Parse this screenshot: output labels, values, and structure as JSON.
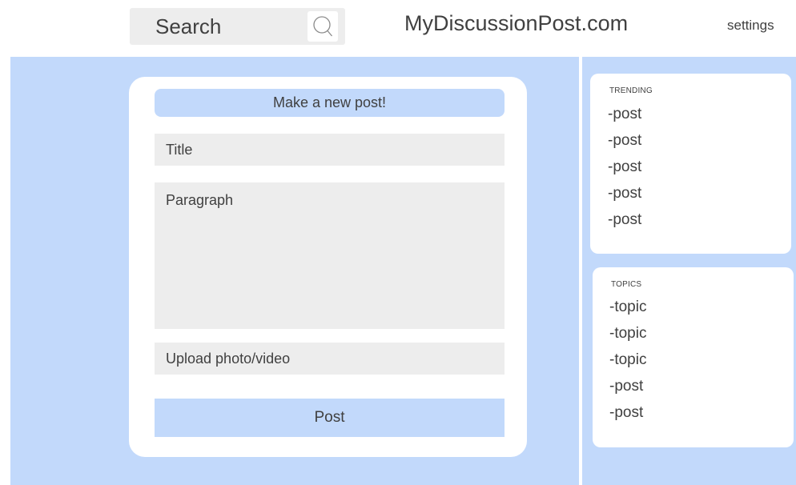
{
  "header": {
    "search_label": "Search",
    "site_title": "MyDiscussionPost.com",
    "settings_label": "settings"
  },
  "post_form": {
    "heading": "Make a new post!",
    "title_placeholder": "Title",
    "paragraph_placeholder": "Paragraph",
    "upload_label": "Upload photo/video",
    "post_button": "Post"
  },
  "trending": {
    "heading": "TRENDING",
    "items": [
      "-post",
      "-post",
      "-post",
      "-post",
      "-post"
    ]
  },
  "topics": {
    "heading": "TOPICS",
    "items": [
      "-topic",
      "-topic",
      "-topic",
      "-post",
      "-post"
    ]
  },
  "colors": {
    "accent_blue": "#c2d9fb",
    "field_gray": "#ededed",
    "text": "#404040"
  },
  "icons": {
    "search": "search-icon"
  }
}
